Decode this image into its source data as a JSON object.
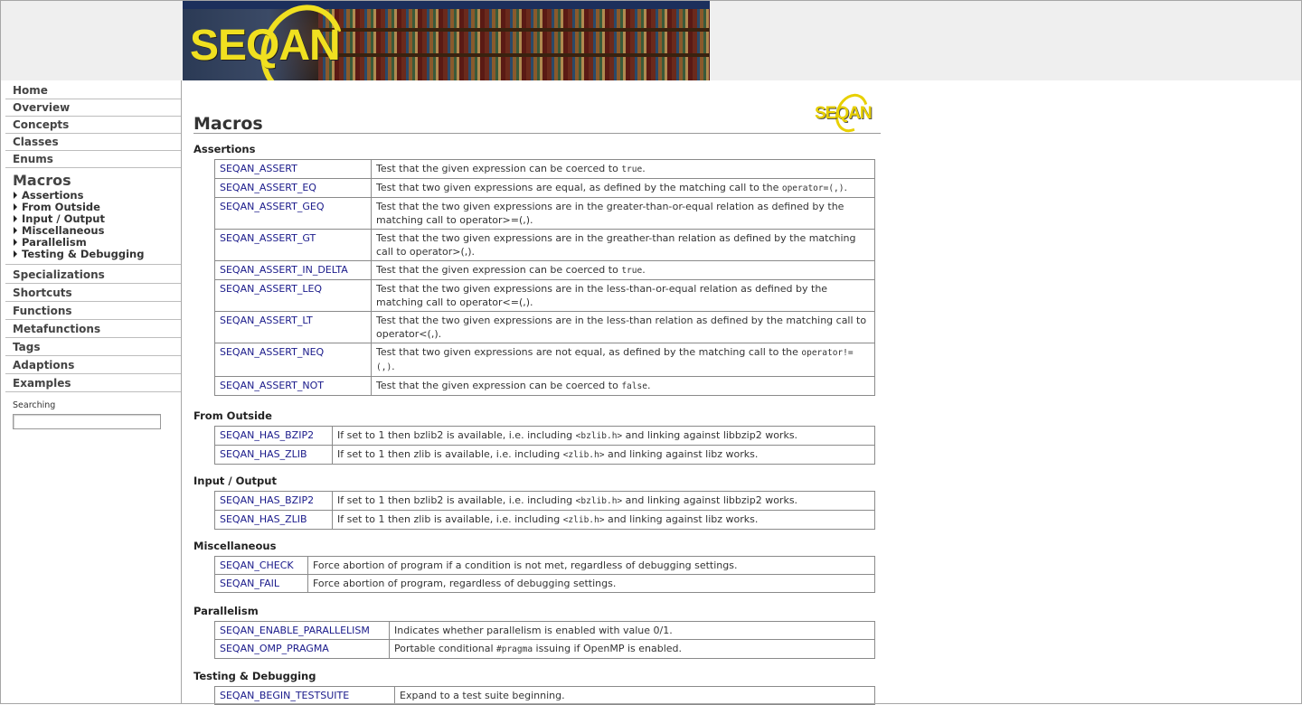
{
  "banner": {
    "logo_text": "SEQAN"
  },
  "sidebar": {
    "items_top": [
      "Home",
      "Overview",
      "Concepts",
      "Classes",
      "Enums"
    ],
    "active": "Macros",
    "sub_items": [
      "Assertions",
      "From Outside",
      "Input / Output",
      "Miscellaneous",
      "Parallelism",
      "Testing & Debugging"
    ],
    "items_bottom": [
      "Specializations",
      "Shortcuts",
      "Functions",
      "Metafunctions",
      "Tags",
      "Adaptions",
      "Examples"
    ],
    "search_label": "Searching",
    "search_value": ""
  },
  "main": {
    "title": "Macros",
    "corner_logo_text": "SEQAN",
    "sections": [
      {
        "title": "Assertions",
        "rows": [
          {
            "name": "SEQAN_ASSERT",
            "desc": "Test that the given expression can be coerced to <code>true</code>."
          },
          {
            "name": "SEQAN_ASSERT_EQ",
            "desc": "Test that two given expressions are equal, as defined by the matching call to the <code>operator=(,)</code>."
          },
          {
            "name": "SEQAN_ASSERT_GEQ",
            "desc": "Test that the two given expressions are in the greater-than-or-equal relation as defined by the matching call to operator>=(,)."
          },
          {
            "name": "SEQAN_ASSERT_GT",
            "desc": "Test that the two given expressions are in the greather-than relation as defined by the matching call to operator>(,)."
          },
          {
            "name": "SEQAN_ASSERT_IN_DELTA",
            "desc": "Test that the given expression can be coerced to <code>true</code>."
          },
          {
            "name": "SEQAN_ASSERT_LEQ",
            "desc": "Test that the two given expressions are in the less-than-or-equal relation as defined by the matching call to operator<=(,)."
          },
          {
            "name": "SEQAN_ASSERT_LT",
            "desc": "Test that the two given expressions are in the less-than relation as defined by the matching call to operator<(,)."
          },
          {
            "name": "SEQAN_ASSERT_NEQ",
            "desc": "Test that two given expressions are not equal, as defined by the matching call to the <code>operator!=(,)</code>."
          },
          {
            "name": "SEQAN_ASSERT_NOT",
            "desc": "Test that the given expression can be coerced to <code>false</code>."
          }
        ]
      },
      {
        "title": "From Outside",
        "rows": [
          {
            "name": "SEQAN_HAS_BZIP2",
            "desc": "If set to 1 then bzlib2 is available, i.e. including <code>&lt;bzlib.h&gt;</code> and linking against libbzip2 works."
          },
          {
            "name": "SEQAN_HAS_ZLIB",
            "desc": "If set to 1 then zlib is available, i.e. including <code>&lt;zlib.h&gt;</code> and linking against libz works."
          }
        ]
      },
      {
        "title": "Input / Output",
        "rows": [
          {
            "name": "SEQAN_HAS_BZIP2",
            "desc": "If set to 1 then bzlib2 is available, i.e. including <code>&lt;bzlib.h&gt;</code> and linking against libbzip2 works."
          },
          {
            "name": "SEQAN_HAS_ZLIB",
            "desc": "If set to 1 then zlib is available, i.e. including <code>&lt;zlib.h&gt;</code> and linking against libz works."
          }
        ]
      },
      {
        "title": "Miscellaneous",
        "rows": [
          {
            "name": "SEQAN_CHECK",
            "desc": "Force abortion of program if a condition is not met, regardless of debugging settings."
          },
          {
            "name": "SEQAN_FAIL",
            "desc": "Force abortion of program, regardless of debugging settings."
          }
        ]
      },
      {
        "title": "Parallelism",
        "rows": [
          {
            "name": "SEQAN_ENABLE_PARALLELISM",
            "desc": "Indicates whether parallelism is enabled with value 0/1."
          },
          {
            "name": "SEQAN_OMP_PRAGMA",
            "desc": "Portable conditional <code>#pragma</code> issuing if OpenMP is enabled."
          }
        ]
      },
      {
        "title": "Testing & Debugging",
        "rows": [
          {
            "name": "SEQAN_BEGIN_TESTSUITE",
            "desc": "Expand to a test suite beginning."
          }
        ]
      }
    ]
  }
}
